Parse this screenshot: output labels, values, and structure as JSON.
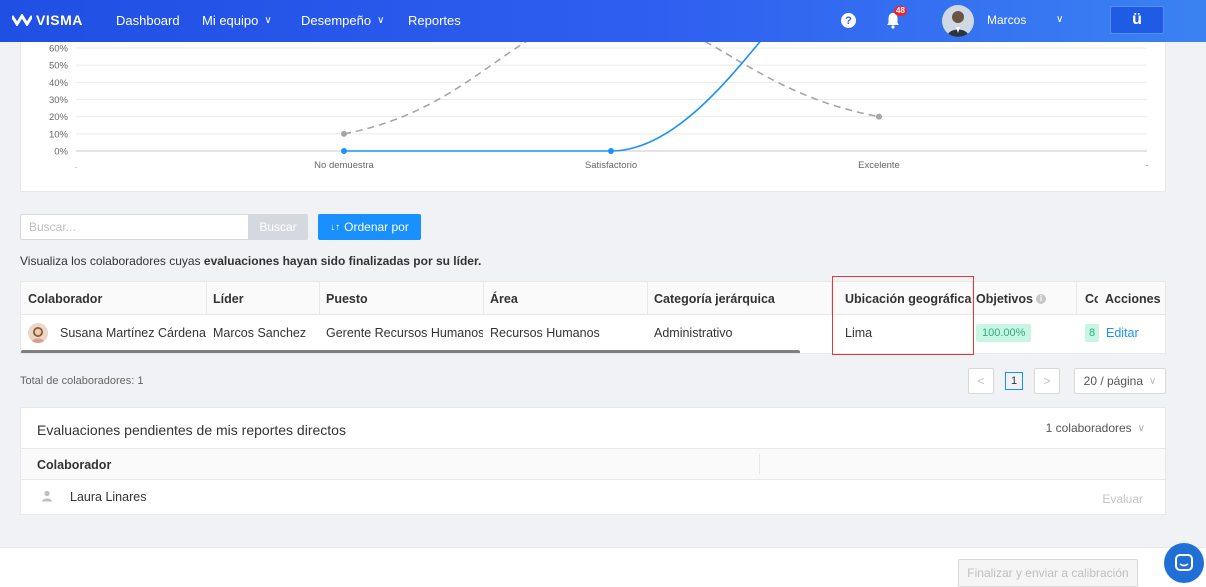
{
  "nav": {
    "brand": "VISMA",
    "items": [
      {
        "label": "Dashboard",
        "chevron": false
      },
      {
        "label": "Mi equipo",
        "chevron": true
      },
      {
        "label": "Desempeño",
        "chevron": true
      },
      {
        "label": "Reportes",
        "chevron": false
      }
    ],
    "help": "?",
    "notifications": "48",
    "user_name": "Marcos",
    "app_button": "ü",
    "accent": "#2f5ff0"
  },
  "chart_data": {
    "type": "line",
    "categories": [
      "No demuestra",
      "Satisfactorio",
      "Excelente"
    ],
    "y_ticks": [
      "60%",
      "50%",
      "40%",
      "30%",
      "20%",
      "10%",
      "0%"
    ],
    "ylim": [
      0,
      60
    ],
    "series": [
      {
        "style": "dashed",
        "color": "#a6a6a6",
        "values": [
          10,
          80,
          20
        ]
      },
      {
        "style": "solid",
        "color": "#1890ff",
        "values": [
          0,
          0,
          100
        ]
      }
    ],
    "x_edge_left": ".",
    "x_edge_right": "-"
  },
  "search": {
    "placeholder": "Buscar...",
    "button": "Buscar",
    "order_button": "Ordenar por"
  },
  "description": {
    "prefix": "Visualiza los colaboradores cuyas ",
    "bold": "evaluaciones hayan sido finalizadas por su líder."
  },
  "table": {
    "headers": [
      "Colaborador",
      "Líder",
      "Puesto",
      "Área",
      "Categoría jerárquica",
      "Ubicación geográfica",
      "Objetivos",
      "Co",
      "Acciones"
    ],
    "row": {
      "colaborador": "Susana Martínez Cárdena...",
      "lider": "Marcos Sanchez",
      "puesto": "Gerente Recursos Humanos",
      "area": "Recursos Humanos",
      "categoria": "Administrativo",
      "ubicacion": "Lima",
      "objetivos": "100.00%",
      "co": "8",
      "accion": "Editar"
    }
  },
  "pagination": {
    "total": "Total de colaboradores: 1",
    "prev": "<",
    "current": "1",
    "next": ">",
    "page_size": "20 / página"
  },
  "pending": {
    "title": "Evaluaciones pendientes de mis reportes directos",
    "count": "1 colaboradores",
    "column": "Colaborador",
    "name": "Laura Linares",
    "action": "Evaluar"
  },
  "footer": {
    "button": "Finalizar y enviar a calibración"
  }
}
